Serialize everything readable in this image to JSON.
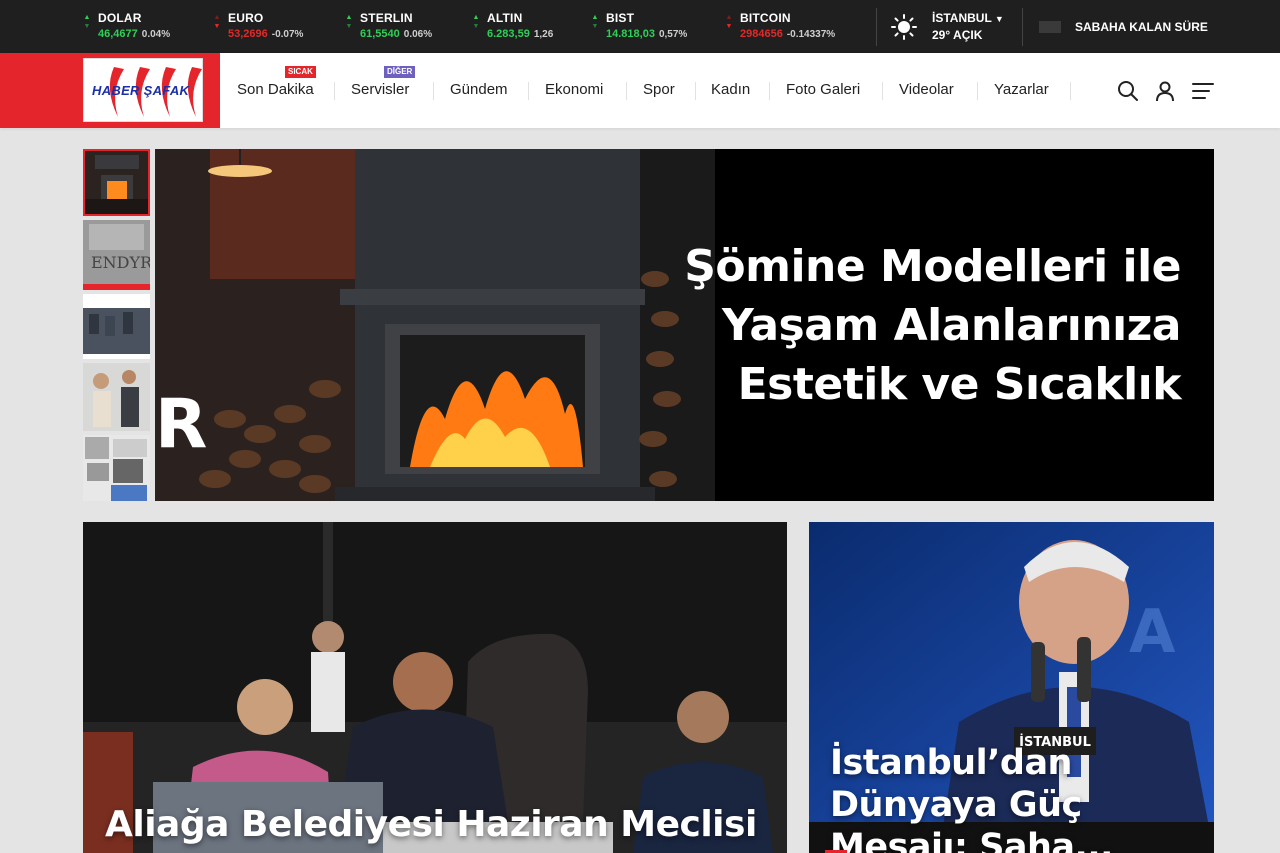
{
  "tickers": [
    {
      "name": "DOLAR",
      "value": "46,4677",
      "change": "0.04%",
      "direction": "up"
    },
    {
      "name": "EURO",
      "value": "53,2696",
      "change": "-0.07%",
      "direction": "down"
    },
    {
      "name": "STERLIN",
      "value": "61,5540",
      "change": "0.06%",
      "direction": "up"
    },
    {
      "name": "ALTIN",
      "value": "6.283,59",
      "change": "1,26",
      "direction": "up"
    },
    {
      "name": "BIST",
      "value": "14.818,03",
      "change": "0,57%",
      "direction": "up"
    },
    {
      "name": "BITCOIN",
      "value": "2984656",
      "change": "-0.14337%",
      "direction": "down"
    }
  ],
  "weather": {
    "city": "İSTANBUL",
    "temp": "29°",
    "condition": "AÇIK",
    "icon": "sun-icon"
  },
  "countdown": {
    "label": "SABAHA KALAN SÜRE"
  },
  "logo": {
    "text": "HABER ŞAFAK"
  },
  "nav": {
    "items": [
      {
        "label": "Son Dakika",
        "badge": "SICAK"
      },
      {
        "label": "Servisler",
        "badge": "DİĞER"
      },
      {
        "label": "Gündem"
      },
      {
        "label": "Ekonomi"
      },
      {
        "label": "Spor"
      },
      {
        "label": "Kadın"
      },
      {
        "label": "Foto Galeri"
      },
      {
        "label": "Videolar"
      },
      {
        "label": "Yazarlar"
      }
    ]
  },
  "header_icons": [
    "search-icon",
    "user-icon",
    "menu-icon"
  ],
  "featured": {
    "title": "Şömine Modelleri ile Yaşam Alanlarınıza Estetik ve Sıcaklık",
    "image_letter": "R"
  },
  "cards": [
    {
      "title": "Aliağa Belediyesi Haziran Meclisi"
    },
    {
      "title": "İstanbul’dan Dünyaya Güç Mesajı: Saha..."
    }
  ],
  "colors": {
    "accent": "#e4262c",
    "up": "#2fcf58",
    "down": "#e02a2a",
    "topbar": "#1f1f1f"
  }
}
